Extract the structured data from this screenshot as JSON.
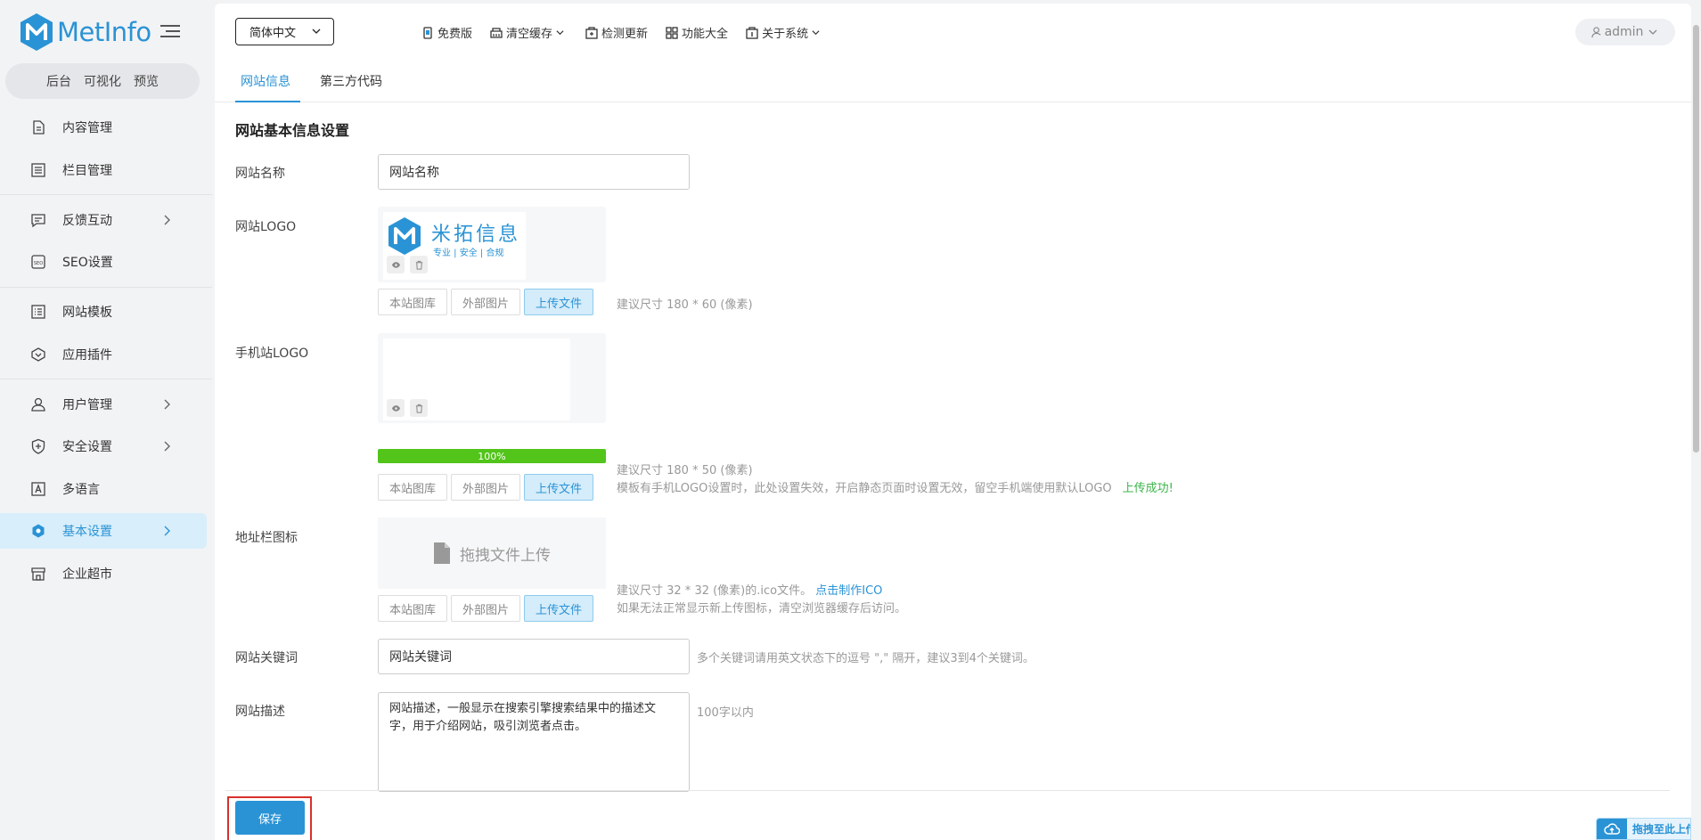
{
  "brand": {
    "name": "MetInfo",
    "color": "#2a93d5"
  },
  "sidebar": {
    "sub_links": [
      "后台",
      "可视化",
      "预览"
    ],
    "items": [
      {
        "label": "内容管理",
        "icon": "file-icon",
        "arrow": false
      },
      {
        "label": "栏目管理",
        "icon": "list-icon",
        "arrow": false
      },
      {
        "label": "反馈互动",
        "icon": "chat-icon",
        "arrow": true
      },
      {
        "label": "SEO设置",
        "icon": "seo-icon",
        "arrow": false
      },
      {
        "label": "网站模板",
        "icon": "template-icon",
        "arrow": false
      },
      {
        "label": "应用插件",
        "icon": "plugin-icon",
        "arrow": false
      },
      {
        "label": "用户管理",
        "icon": "user-icon",
        "arrow": true
      },
      {
        "label": "安全设置",
        "icon": "shield-icon",
        "arrow": true
      },
      {
        "label": "多语言",
        "icon": "language-icon",
        "arrow": false
      },
      {
        "label": "基本设置",
        "icon": "settings-icon",
        "arrow": true,
        "active": true
      },
      {
        "label": "企业超市",
        "icon": "store-icon",
        "arrow": false
      }
    ]
  },
  "topbar": {
    "language": "简体中文",
    "links": [
      {
        "label": "免费版",
        "icon": "badge-icon",
        "dropdown": false
      },
      {
        "label": "清空缓存",
        "icon": "broom-icon",
        "dropdown": true
      },
      {
        "label": "检测更新",
        "icon": "update-icon",
        "dropdown": false
      },
      {
        "label": "功能大全",
        "icon": "grid-icon",
        "dropdown": false
      },
      {
        "label": "关于系统",
        "icon": "info-icon",
        "dropdown": true
      }
    ],
    "user": "admin"
  },
  "tabs": [
    {
      "label": "网站信息",
      "active": true
    },
    {
      "label": "第三方代码",
      "active": false
    }
  ],
  "form": {
    "section_title": "网站基本信息设置",
    "site_name": {
      "label": "网站名称",
      "value": "网站名称"
    },
    "logo": {
      "label": "网站LOGO",
      "preview_cn": "米拓信息",
      "preview_sub": "专业 | 安全 | 合规",
      "hint": "建议尺寸 180 * 60 (像素)"
    },
    "mobile_logo": {
      "label": "手机站LOGO",
      "progress": 100,
      "progress_text": "100%",
      "hint": "建议尺寸 180 * 50 (像素)",
      "note": "模板有手机LOGO设置时，此处设置失效，开启静态页面时设置无效，留空手机端使用默认LOGO",
      "success": "上传成功!"
    },
    "favicon": {
      "label": "地址栏图标",
      "drag_text": "拖拽文件上传",
      "hint_prefix": "建议尺寸 32 * 32 (像素)的.ico文件。",
      "hint_link": "点击制作ICO",
      "hint2": "如果无法正常显示新上传图标，清空浏览器缓存后访问。"
    },
    "upload_buttons": {
      "library": "本站图库",
      "external": "外部图片",
      "upload": "上传文件"
    },
    "keywords": {
      "label": "网站关键词",
      "value": "网站关键词",
      "hint": "多个关键词请用英文状态下的逗号 \",\" 隔开，建议3到4个关键词。"
    },
    "description": {
      "label": "网站描述",
      "value": "网站描述，一般显示在搜索引擎搜索结果中的描述文字，用于介绍网站，吸引浏览者点击。",
      "hint": "100字以内"
    },
    "save_label": "保存"
  },
  "float_upload": "拖拽至此上传",
  "colors": {
    "accent": "#2a93d5",
    "success": "#52c41a",
    "highlight": "#d9302c"
  }
}
